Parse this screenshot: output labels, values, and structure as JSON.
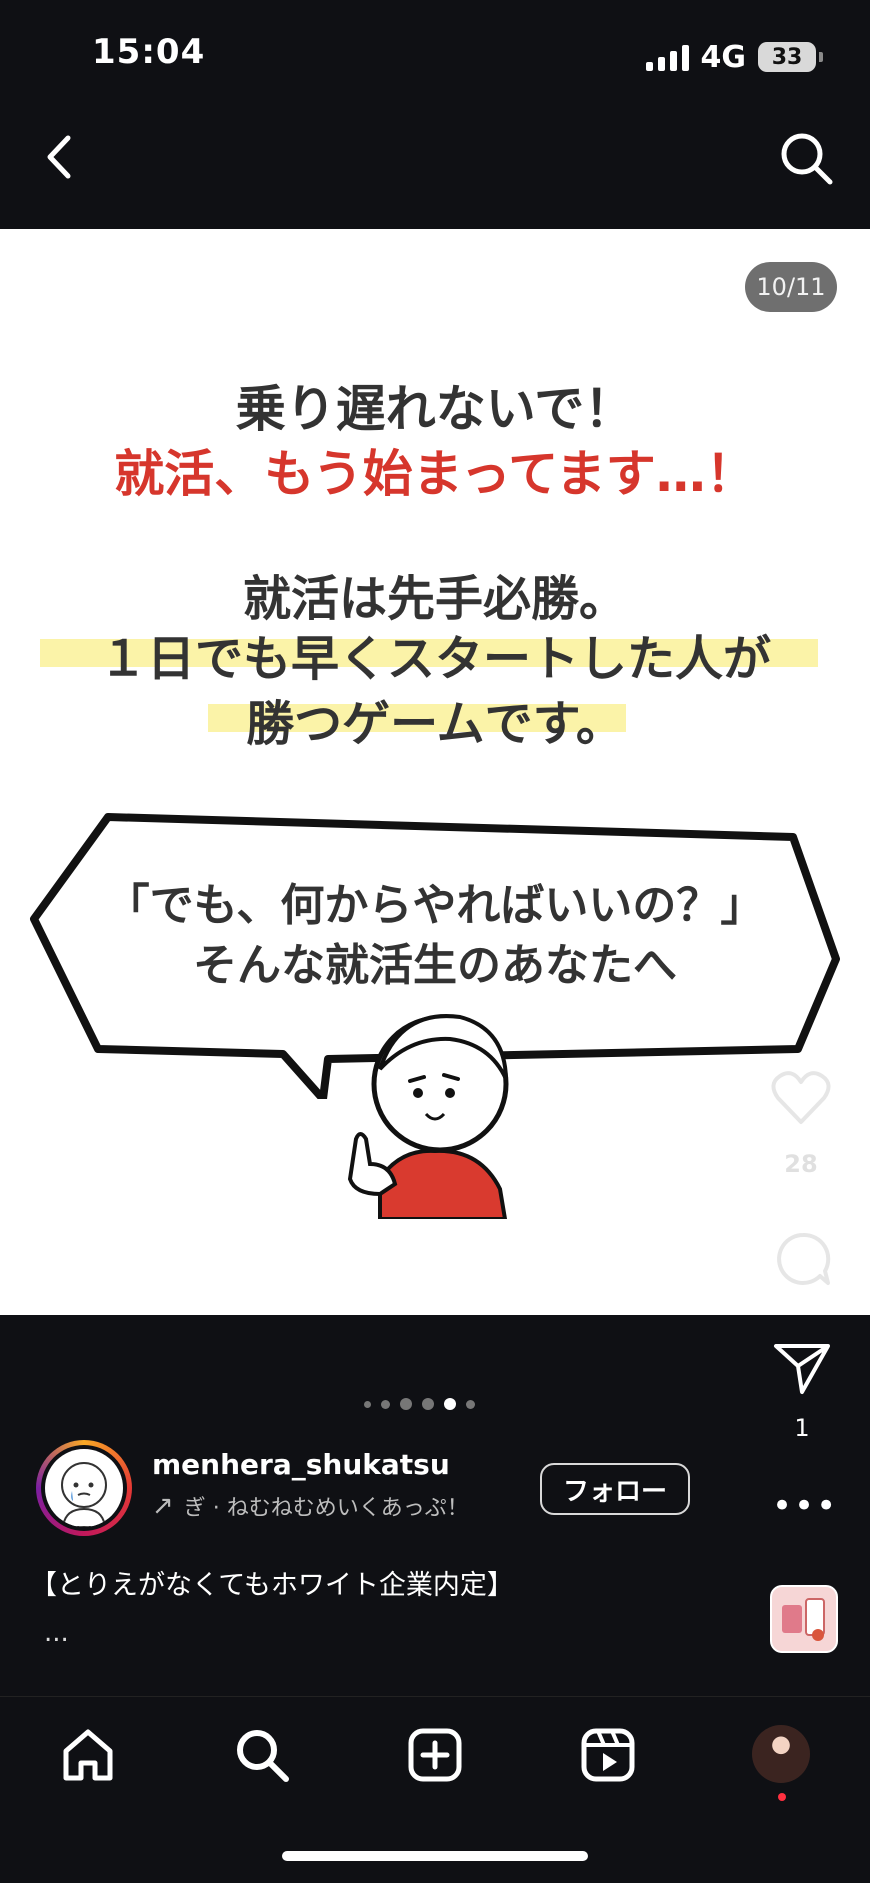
{
  "status_bar": {
    "time": "15:04",
    "network": "4G",
    "battery": "33"
  },
  "post": {
    "counter": "10/11",
    "slide_text": {
      "line1": "乗り遅れないで！",
      "line2": "就活、もう始まってます…！",
      "line3": "就活は先手必勝。",
      "line4": "１日でも早くスタートした人が",
      "line5": "勝つゲームです。",
      "bubble1": "「でも、何からやればいいの？」",
      "bubble2": "そんな就活生のあなたへ"
    },
    "likes": "28",
    "shares": "1",
    "page_dots": 6,
    "active_dot": 4
  },
  "author": {
    "username": "menhera_shukatsu",
    "music": "ぎ · ねむねむめいくあっぷ！",
    "follow_label": "フォロー"
  },
  "caption": {
    "text": "【とりえがなくてもホワイト企業内定】",
    "more": "..."
  },
  "colors": {
    "accent_red": "#d6362c",
    "highlight": "#fbf3a8",
    "background": "#0f1014"
  },
  "icons": [
    "back-icon",
    "search-icon",
    "heart-icon",
    "comment-icon",
    "share-icon",
    "more-icon",
    "home-icon",
    "add-icon",
    "reels-icon"
  ]
}
